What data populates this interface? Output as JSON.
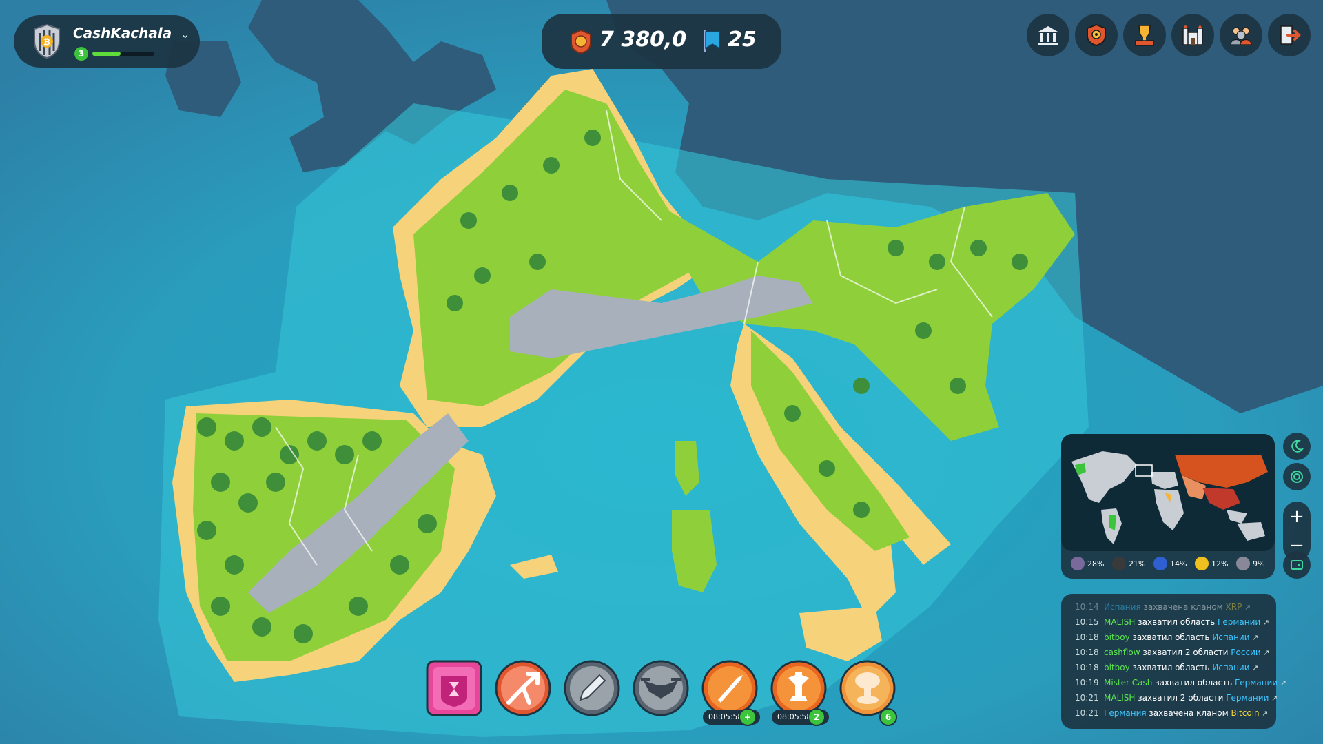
{
  "player": {
    "name": "CashKachala",
    "level": "3",
    "xp_fraction": 0.45
  },
  "resources": {
    "coins": "7 380,0",
    "banners": "25"
  },
  "top_buttons": [
    {
      "name": "bank-button",
      "icon": "bank-icon"
    },
    {
      "name": "clan-button",
      "icon": "shield-gear-icon"
    },
    {
      "name": "leaderboard-button",
      "icon": "trophy-icon"
    },
    {
      "name": "castle-button",
      "icon": "castle-icon"
    },
    {
      "name": "army-button",
      "icon": "warriors-icon"
    },
    {
      "name": "logout-button",
      "icon": "exit-icon"
    }
  ],
  "side_buttons": [
    {
      "name": "night-mode-button",
      "icon": "moon-icon"
    },
    {
      "name": "radar-button",
      "icon": "radar-icon"
    }
  ],
  "zoom": {
    "in": "+",
    "out": "−"
  },
  "minimap": {
    "stats": [
      {
        "icon": "coin-a-icon",
        "color": "#7a6a9c",
        "pct": "28%"
      },
      {
        "icon": "ethereum-icon",
        "color": "#3a3a3a",
        "pct": "21%"
      },
      {
        "icon": "litecoin-icon",
        "color": "#2f5fd0",
        "pct": "14%"
      },
      {
        "icon": "gold-coin-icon",
        "color": "#f0c020",
        "pct": "12%"
      },
      {
        "icon": "xrp-icon",
        "color": "#888898",
        "pct": "9%"
      }
    ]
  },
  "log": [
    {
      "time": "10:14",
      "parts": [
        [
          "r",
          "Испания"
        ],
        [
          "n",
          " захвачена кланом "
        ],
        [
          "c",
          "XRP"
        ]
      ]
    },
    {
      "time": "10:15",
      "parts": [
        [
          "p",
          "MALISH"
        ],
        [
          "n",
          " захватил область "
        ],
        [
          "r",
          "Германии"
        ]
      ]
    },
    {
      "time": "10:18",
      "parts": [
        [
          "p",
          "bitboy"
        ],
        [
          "n",
          " захватил область "
        ],
        [
          "r",
          "Испании"
        ]
      ]
    },
    {
      "time": "10:18",
      "parts": [
        [
          "p",
          "cashflow"
        ],
        [
          "n",
          " захватил 2 области "
        ],
        [
          "r",
          "России"
        ]
      ]
    },
    {
      "time": "10:18",
      "parts": [
        [
          "p",
          "bitboy"
        ],
        [
          "n",
          " захватил область "
        ],
        [
          "r",
          "Испании"
        ]
      ]
    },
    {
      "time": "10:19",
      "parts": [
        [
          "p",
          "Mister Cash"
        ],
        [
          "n",
          " захватил область "
        ],
        [
          "r",
          "Германии"
        ]
      ]
    },
    {
      "time": "10:21",
      "parts": [
        [
          "p",
          "MALISH"
        ],
        [
          "n",
          " захватил 2 области "
        ],
        [
          "r",
          "Германии"
        ]
      ]
    },
    {
      "time": "10:21",
      "parts": [
        [
          "r",
          "Германия"
        ],
        [
          "n",
          " захвачена кланом "
        ],
        [
          "c",
          "Bitcoin"
        ]
      ]
    }
  ],
  "actions": [
    {
      "name": "shield-timer-action",
      "icon": "hourglass-shield-icon"
    },
    {
      "name": "split-attack-action",
      "icon": "split-arrows-icon"
    },
    {
      "name": "edit-action",
      "icon": "pencil-icon"
    },
    {
      "name": "drone-action",
      "icon": "drone-icon"
    },
    {
      "name": "missile-action",
      "icon": "missile-icon",
      "timer": "08:05:58",
      "badge": "+"
    },
    {
      "name": "rocket-launch-action",
      "icon": "rocket-icon",
      "timer": "08:05:58",
      "badge": "2"
    },
    {
      "name": "nuke-action",
      "icon": "nuke-icon",
      "badge": "6"
    }
  ]
}
